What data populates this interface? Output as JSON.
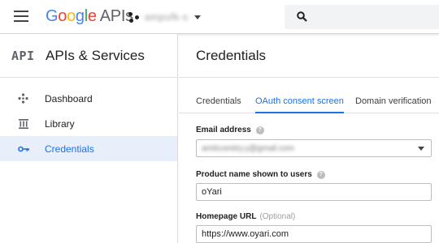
{
  "header": {
    "logo_letters": [
      "G",
      "o",
      "o",
      "g",
      "l",
      "e"
    ],
    "logo_suffix": "APIs",
    "project_name": "ampufk-s",
    "search_placeholder": ""
  },
  "sidebar": {
    "api_mark": "API",
    "title": "APIs & Services",
    "items": [
      {
        "label": "Dashboard",
        "icon": "dashboard-icon",
        "active": false
      },
      {
        "label": "Library",
        "icon": "library-icon",
        "active": false
      },
      {
        "label": "Credentials",
        "icon": "key-icon",
        "active": true
      }
    ]
  },
  "main": {
    "title": "Credentials",
    "tabs": [
      {
        "label": "Credentials",
        "active": false
      },
      {
        "label": "OAuth consent screen",
        "active": true
      },
      {
        "label": "Domain verification",
        "active": false
      }
    ],
    "form": {
      "email_label": "Email address",
      "email_value": "amitcoestry.y@gmail.com",
      "product_label": "Product name shown to users",
      "product_value": "oYari",
      "homepage_label": "Homepage URL",
      "homepage_optional": "(Optional)",
      "homepage_value": "https://www.oyari.com"
    }
  },
  "colors": {
    "accent": "#1a73e8",
    "active_nav_bg": "#e8eefa"
  }
}
